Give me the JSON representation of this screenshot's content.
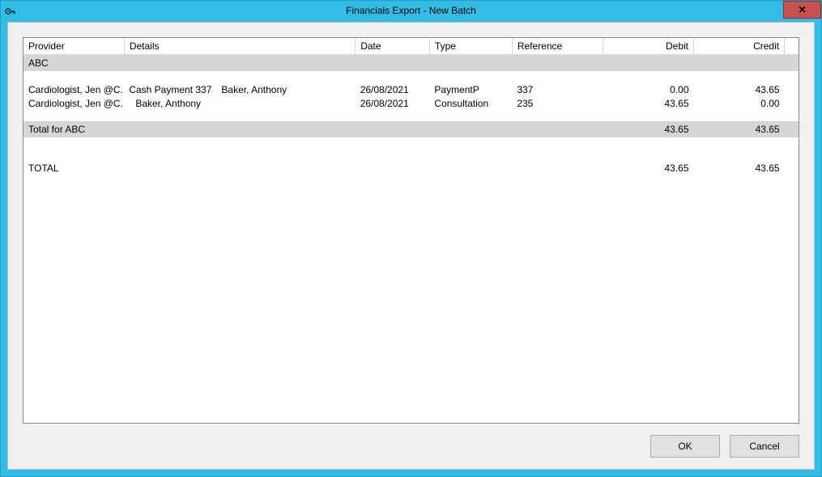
{
  "window": {
    "title": "Financials Export - New Batch"
  },
  "columns": {
    "provider": "Provider",
    "details": "Details",
    "date": "Date",
    "type": "Type",
    "reference": "Reference",
    "debit": "Debit",
    "credit": "Credit"
  },
  "group": {
    "name": "ABC",
    "rows": [
      {
        "provider": "Cardiologist, Jen @C...",
        "details_a": "Cash Payment  337",
        "details_b": "Baker, Anthony",
        "date": "26/08/2021",
        "type": "PaymentP",
        "reference": "337",
        "debit": "0.00",
        "credit": "43.65"
      },
      {
        "provider": "Cardiologist, Jen @C...",
        "details_a": "",
        "details_b": "Baker, Anthony",
        "date": "26/08/2021",
        "type": "Consultation",
        "reference": "235",
        "debit": "43.65",
        "credit": "0.00"
      }
    ],
    "subtotal": {
      "label": "Total for ABC",
      "debit": "43.65",
      "credit": "43.65"
    }
  },
  "grand": {
    "label": "TOTAL",
    "debit": "43.65",
    "credit": "43.65"
  },
  "buttons": {
    "ok": "OK",
    "cancel": "Cancel"
  }
}
